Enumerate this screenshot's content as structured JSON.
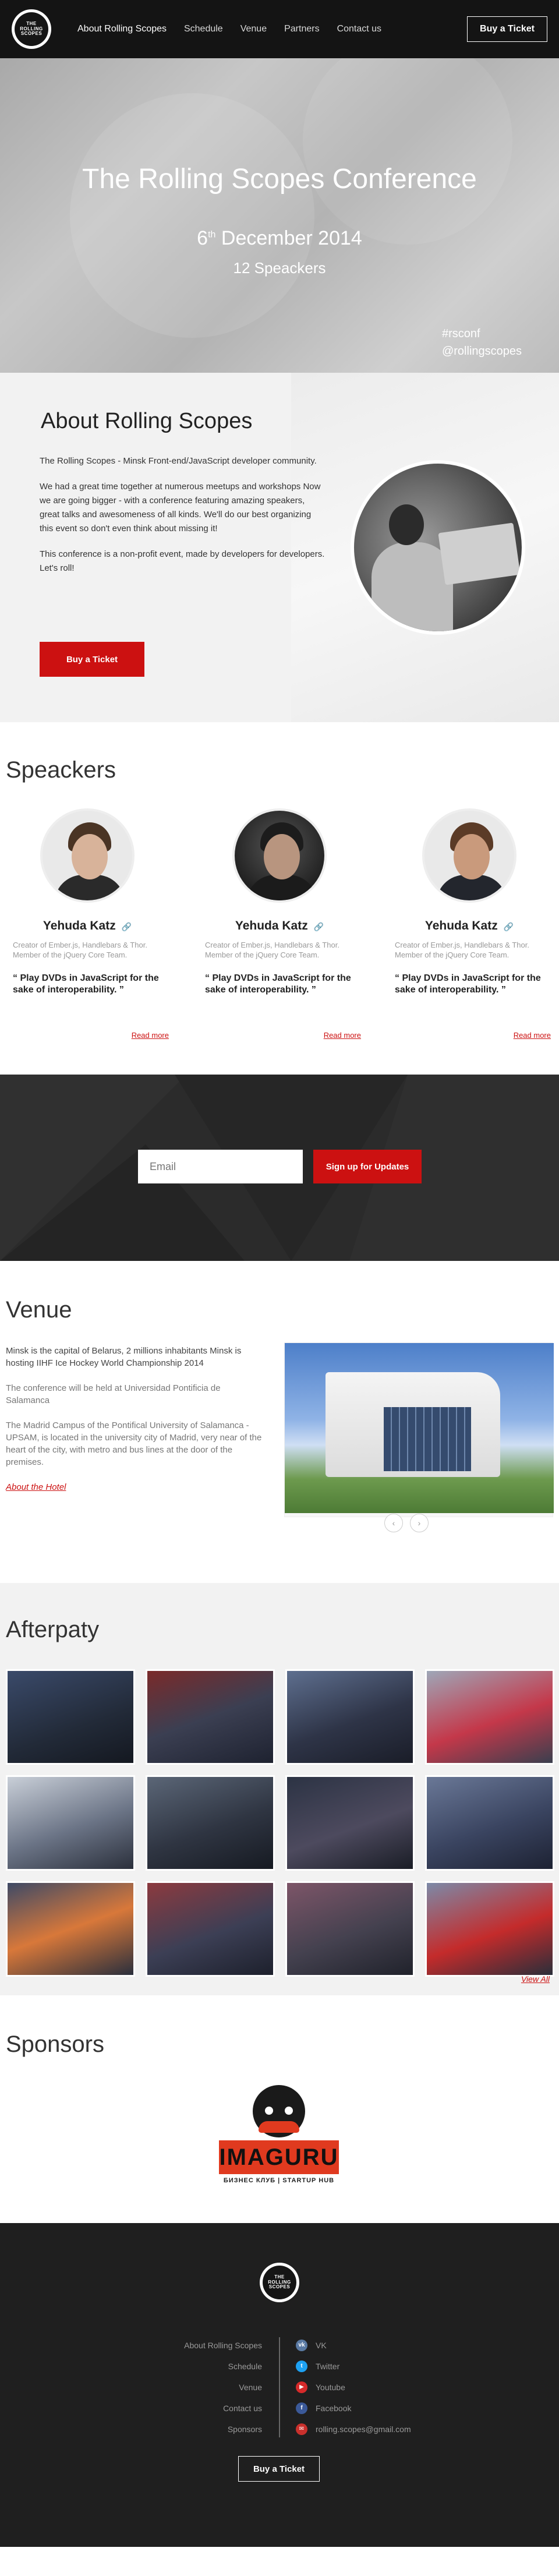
{
  "header": {
    "logo_text": "THE ROLLING SCOPES",
    "nav": [
      {
        "label": "About Rolling Scopes",
        "active": true
      },
      {
        "label": "Schedule",
        "active": false
      },
      {
        "label": "Venue",
        "active": false
      },
      {
        "label": "Partners",
        "active": false
      },
      {
        "label": "Contact us",
        "active": false
      }
    ],
    "ticket_label": "Buy a Ticket"
  },
  "hero": {
    "title": "The Rolling Scopes Conference",
    "date_day": "6",
    "date_suffix": "th",
    "date_rest": " December 2014",
    "speakers": "12 Speackers",
    "hashtag": "#rsconf",
    "handle": "@rollingscopes"
  },
  "about": {
    "title": "About Rolling Scopes",
    "paragraphs": [
      "The Rolling Scopes - Minsk Front-end/JavaScript developer community.",
      "We had a great time together at numerous meetups and workshops Now we are going bigger - with a conference featuring amazing speakers, great talks and awesomeness of all kinds. We'll do our best organizing this event so don't even think about missing it!",
      "This conference is a non-profit event, made by developers for developers. Let's roll!"
    ],
    "button_label": "Buy a Ticket"
  },
  "speakers": {
    "title": "Speackers",
    "items": [
      {
        "name": "Yehuda Katz",
        "role": "Creator of Ember.js, Handlebars & Thor. Member of the jQuery Core Team.",
        "quote": "“ Play DVDs in JavaScript for the sake of interoperability. ”",
        "read_more": "Read more"
      },
      {
        "name": "Yehuda Katz",
        "role": "Creator of Ember.js, Handlebars & Thor. Member of the jQuery Core Team.",
        "quote": "“ Play DVDs in JavaScript for the sake of interoperability. ”",
        "read_more": "Read more"
      },
      {
        "name": "Yehuda Katz",
        "role": "Creator of Ember.js, Handlebars & Thor. Member of the jQuery Core Team.",
        "quote": "“ Play DVDs in JavaScript for the sake of interoperability. ”",
        "read_more": "Read more"
      }
    ]
  },
  "subscribe": {
    "email_placeholder": "Email",
    "button_label": "Sign up for Updates"
  },
  "venue": {
    "title": "Venue",
    "line1": "Minsk is the capital of Belarus, 2 millions inhabitants Minsk is hosting IIHF Ice Hockey World Championship 2014",
    "line2": "The conference will be held at Universidad Pontificia de Salamanca",
    "line3": "The Madrid Campus of the Pontifical University of Salamanca - UPSAM, is located in the university city of Madrid, very near of the heart of the city, with metro and bus lines at the door of the premises.",
    "link": "About the Hotel"
  },
  "afterparty": {
    "title": "Afterpaty",
    "view_all": "View All"
  },
  "sponsors": {
    "title": "Sponsors",
    "sponsor_name": "IMAGURU",
    "sponsor_tagline": "БИЗНЕС КЛУБ | STARTUP HUB"
  },
  "footer": {
    "links": [
      "About Rolling Scopes",
      "Schedule",
      "Venue",
      "Contact us",
      "Sponsors"
    ],
    "social": [
      {
        "label": "VK",
        "icon": "vk-icon",
        "color": "#5a7aa3"
      },
      {
        "label": "Twitter",
        "icon": "twitter-icon",
        "color": "#1da1f2"
      },
      {
        "label": "Youtube",
        "icon": "youtube-icon",
        "color": "#d62a2a"
      },
      {
        "label": "Facebook",
        "icon": "facebook-icon",
        "color": "#3b5998"
      },
      {
        "label": "rolling.scopes@gmail.com",
        "icon": "mail-icon",
        "color": "#c9302c"
      }
    ],
    "ticket_label": "Buy a Ticket"
  },
  "colors": {
    "accent": "#cc1111",
    "header_bg": "#141414",
    "footer_bg": "#1f1f1f"
  }
}
